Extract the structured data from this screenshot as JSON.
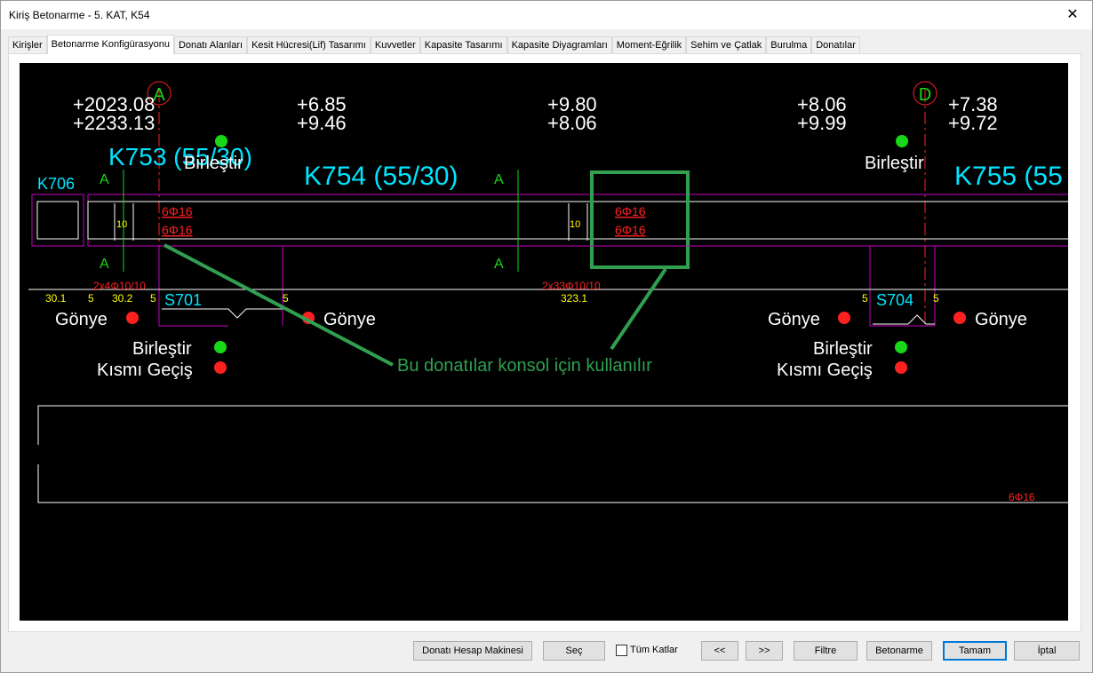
{
  "window": {
    "title": "Kiriş Betonarme - 5. KAT, K54",
    "close_glyph": "✕"
  },
  "tabs": [
    "Kirişler",
    "Betonarme Konfigürasyonu",
    "Donatı Alanları",
    "Kesit Hücresi(Lif) Tasarımı",
    "Kuvvetler",
    "Kapasite Tasarımı",
    "Kapasite Diyagramları",
    "Moment-Eğrilik",
    "Sehim ve Çatlak",
    "Burulma",
    "Donatılar"
  ],
  "active_tab": "Betonarme Konfigürasyonu",
  "drawing": {
    "colors": {
      "cyan": "#00e5ff",
      "green": "#18d818",
      "red": "#ff2020",
      "magenta": "#c800c8",
      "yellow": "#ffff00",
      "annotation": "#30a050",
      "white": "#ffffff"
    },
    "axis_a": "A",
    "axis_d": "D",
    "elev_a_top": "+2023.08",
    "elev_a_bot": "+2233.13",
    "elev_1_top": "+6.85",
    "elev_1_bot": "+9.46",
    "elev_2_top": "+9.80",
    "elev_2_bot": "+8.06",
    "elev_3_top": "+8.06",
    "elev_3_bot": "+9.99",
    "elev_4_top": "+7.38",
    "elev_4_bot": "+9.72",
    "beam_k753": "K753 (55/30)",
    "beam_k754": "K754 (55/30)",
    "beam_k755": "K755 (55",
    "beam_k706": "K706",
    "birlestir": "Birleştir",
    "gonye": "Gönye",
    "kismi_gecis": "Kısmı Geçiş",
    "section_a": "A",
    "rebar_top": "6Φ16",
    "rebar_bot": "6Φ16",
    "dim_10": "10",
    "stirrup_1": "2x4Φ10/10",
    "stirrup_2": "2x33Φ10/10",
    "dim_30_1": "30.1",
    "dim_5": "5",
    "dim_30_2": "30.2",
    "dim_323_1": "323.1",
    "slab_s701": "S701",
    "slab_s704": "S704",
    "annotation": "Bu donatılar konsol için kullanılır",
    "lower_rebar": "6Φ16"
  },
  "buttons": {
    "calculator": "Donatı Hesap Makinesi",
    "select": "Seç",
    "all_floors": "Tüm Katlar",
    "prev": "<<",
    "next": ">>",
    "filter": "Filtre",
    "concrete": "Betonarme",
    "ok": "Tamam",
    "cancel": "İptal"
  }
}
